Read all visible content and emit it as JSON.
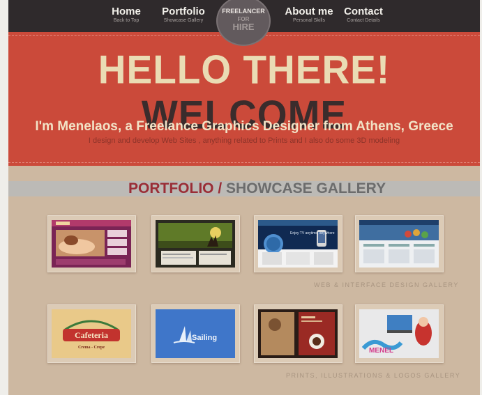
{
  "nav": {
    "items": [
      {
        "label": "Home",
        "sub": "Back to Top"
      },
      {
        "label": "Portfolio",
        "sub": "Showcase Gallery"
      },
      {
        "label": "About me",
        "sub": "Personal Skills"
      },
      {
        "label": "Contact",
        "sub": "Contact Details"
      }
    ],
    "badge": {
      "line1": "FREELANCER",
      "line2": "FOR",
      "line3": "HIRE"
    }
  },
  "hero": {
    "headline_part1": "HELLO THERE!",
    "headline_part2": "WELCOME",
    "intro": "I'm Menelaos, a Freelance Graphics Designer from Athens, Greece",
    "description": "I design and develop Web Sites , anything related to Prints and I also do some 3D modeling"
  },
  "portfolio": {
    "title_part1": "PORTFOLIO /",
    "title_part2": "SHOWCASE GALLERY",
    "web_gallery_caption": "WEB & INTERFACE DESIGN GALLERY",
    "prints_gallery_caption": "PRINTS, ILLUSTRATIONS & LOGOS GALLERY",
    "thumb_texts": {
      "cafeteria": "Cafeteria",
      "cafeteria_sub": "Crema - Crepe",
      "sailing": "Sailing",
      "phone_tagline": "Enjoy TV anytime, anywhere",
      "graffiti": "MENEL"
    }
  },
  "colors": {
    "nav_bg": "#2f2a2c",
    "hero_red": "#cb4a3a",
    "headline_cream": "#eadcb4",
    "headline_dark": "#3a2c2c",
    "content_tan": "#cdb8a1",
    "title_red": "#9a2d36"
  }
}
